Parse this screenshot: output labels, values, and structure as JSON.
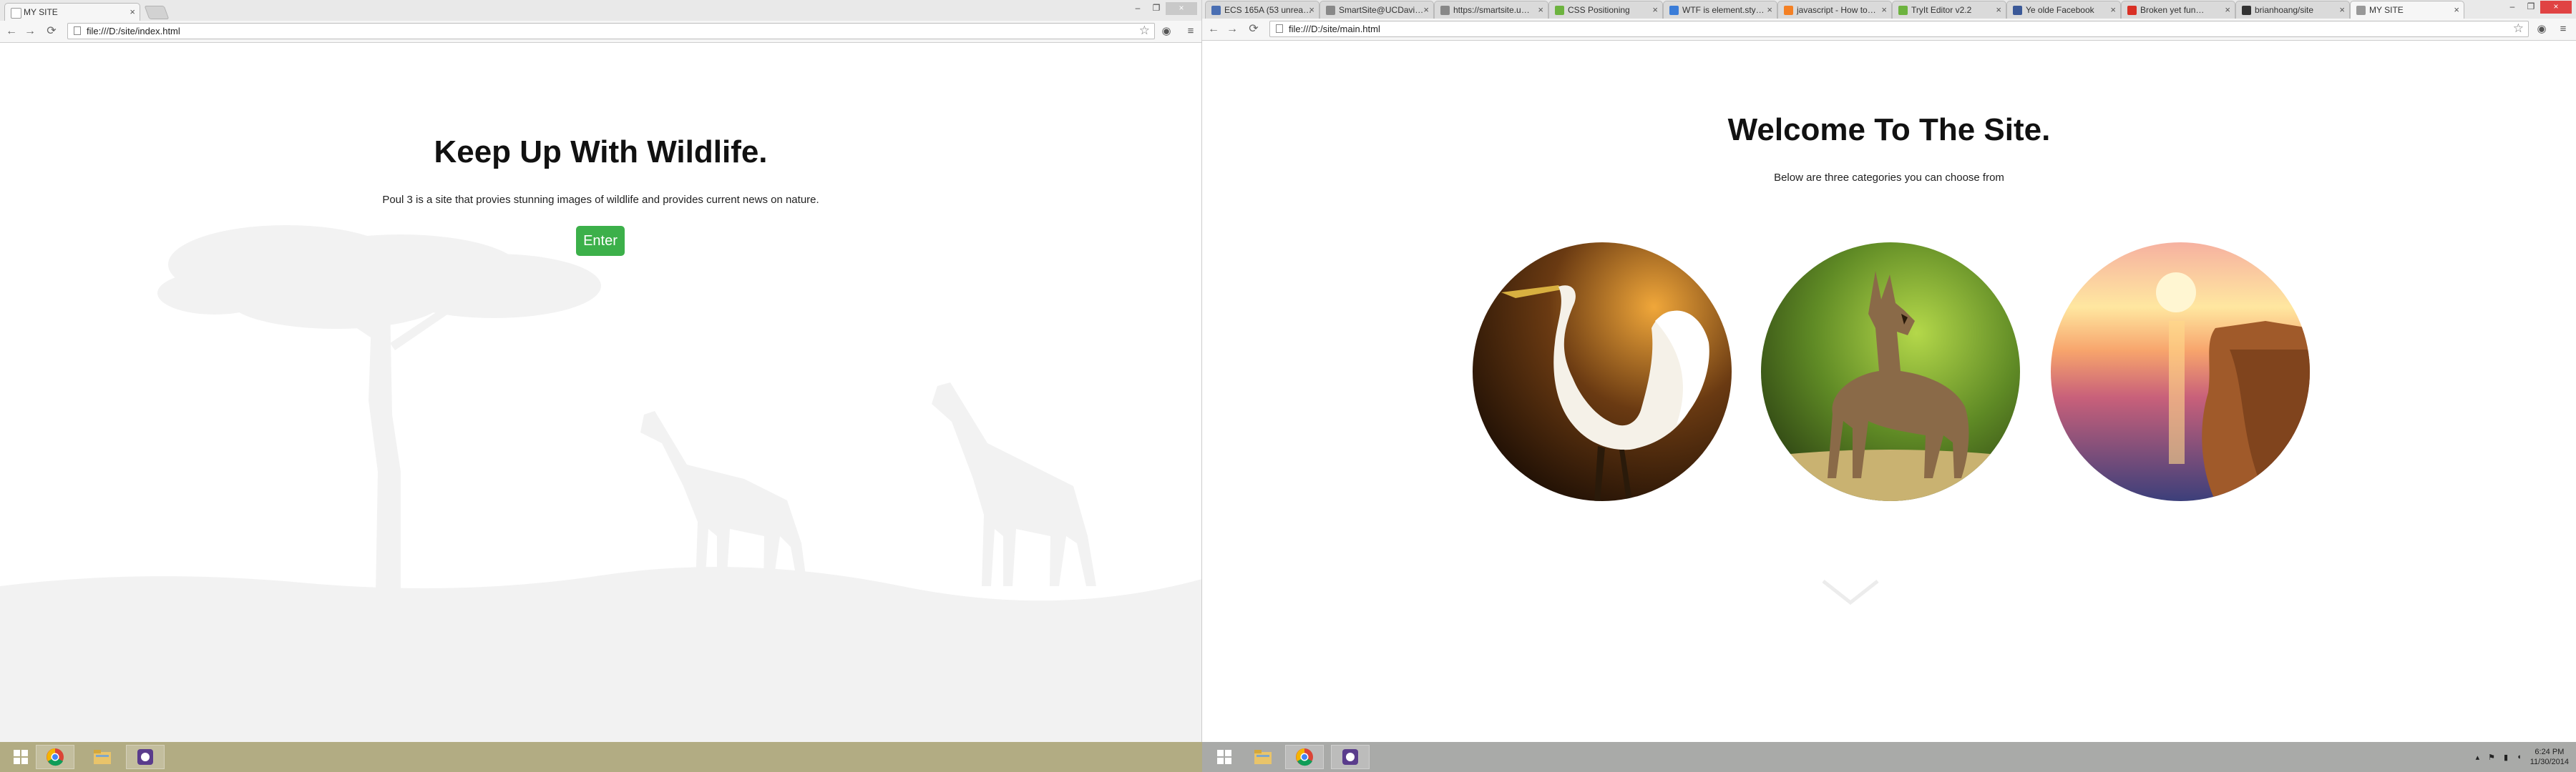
{
  "left_window": {
    "tab": {
      "title": "MY SITE",
      "close": "×"
    },
    "controls": {
      "minimize": "–",
      "restore": "❐",
      "close": "×"
    },
    "nav": {
      "back": "←",
      "forward": "→",
      "reload": "⟳"
    },
    "address": "file:///D:/site/index.html",
    "menu_icon": "≡",
    "page": {
      "title": "Keep Up With Wildlife.",
      "subtitle": "Poul 3 is a site that provies stunning images of wildlife and provides current news on nature.",
      "button": "Enter"
    }
  },
  "right_window": {
    "tabs": [
      {
        "title": "ECS 165A (53 unrea…",
        "icon_color": "#4a6fb3"
      },
      {
        "title": "SmartSite@UCDavi…",
        "icon_color": "#888888"
      },
      {
        "title": "https://smartsite.u…",
        "icon_color": "#888888"
      },
      {
        "title": "CSS Positioning",
        "icon_color": "#6db33f"
      },
      {
        "title": "WTF is element.sty…",
        "icon_color": "#3b7dd8"
      },
      {
        "title": "javascript - How to…",
        "icon_color": "#f48024"
      },
      {
        "title": "TryIt Editor v2.2",
        "icon_color": "#6db33f"
      },
      {
        "title": "Ye olde Facebook",
        "icon_color": "#3b5998"
      },
      {
        "title": "Broken yet fun…",
        "icon_color": "#d93025"
      },
      {
        "title": "brianhoang/site",
        "icon_color": "#333333"
      },
      {
        "title": "MY SITE",
        "icon_color": "#999999",
        "active": true
      }
    ],
    "tab_close": "×",
    "controls": {
      "minimize": "–",
      "restore": "❐",
      "close": "×"
    },
    "nav": {
      "back": "←",
      "forward": "→",
      "reload": "⟳"
    },
    "address": "file:///D:/site/main.html",
    "menu_icon": "≡",
    "page": {
      "title": "Welcome To The Site.",
      "subtitle": "Below are three categories you can choose from",
      "categories": [
        {
          "name": "egret-image",
          "colors": [
            "#e89a35",
            "#5a2f10",
            "#1b0d05"
          ]
        },
        {
          "name": "deer-image",
          "colors": [
            "#8fb83a",
            "#3f5e1c",
            "#c9a56b"
          ]
        },
        {
          "name": "sunset-sea-image",
          "colors": [
            "#ffe7a0",
            "#f47a54",
            "#3c3f7a"
          ]
        }
      ]
    }
  },
  "taskbar": {
    "left_bg": "#b2ac83",
    "right_bg": "#a9aaa8",
    "apps": [
      "windows-start",
      "chrome",
      "file-explorer",
      "app-purple"
    ],
    "clock": {
      "time": "6:24 PM",
      "date": "11/30/2014"
    }
  },
  "colors": {
    "button_green": "#3cb04a",
    "silhouette": "#f2f2f2"
  }
}
